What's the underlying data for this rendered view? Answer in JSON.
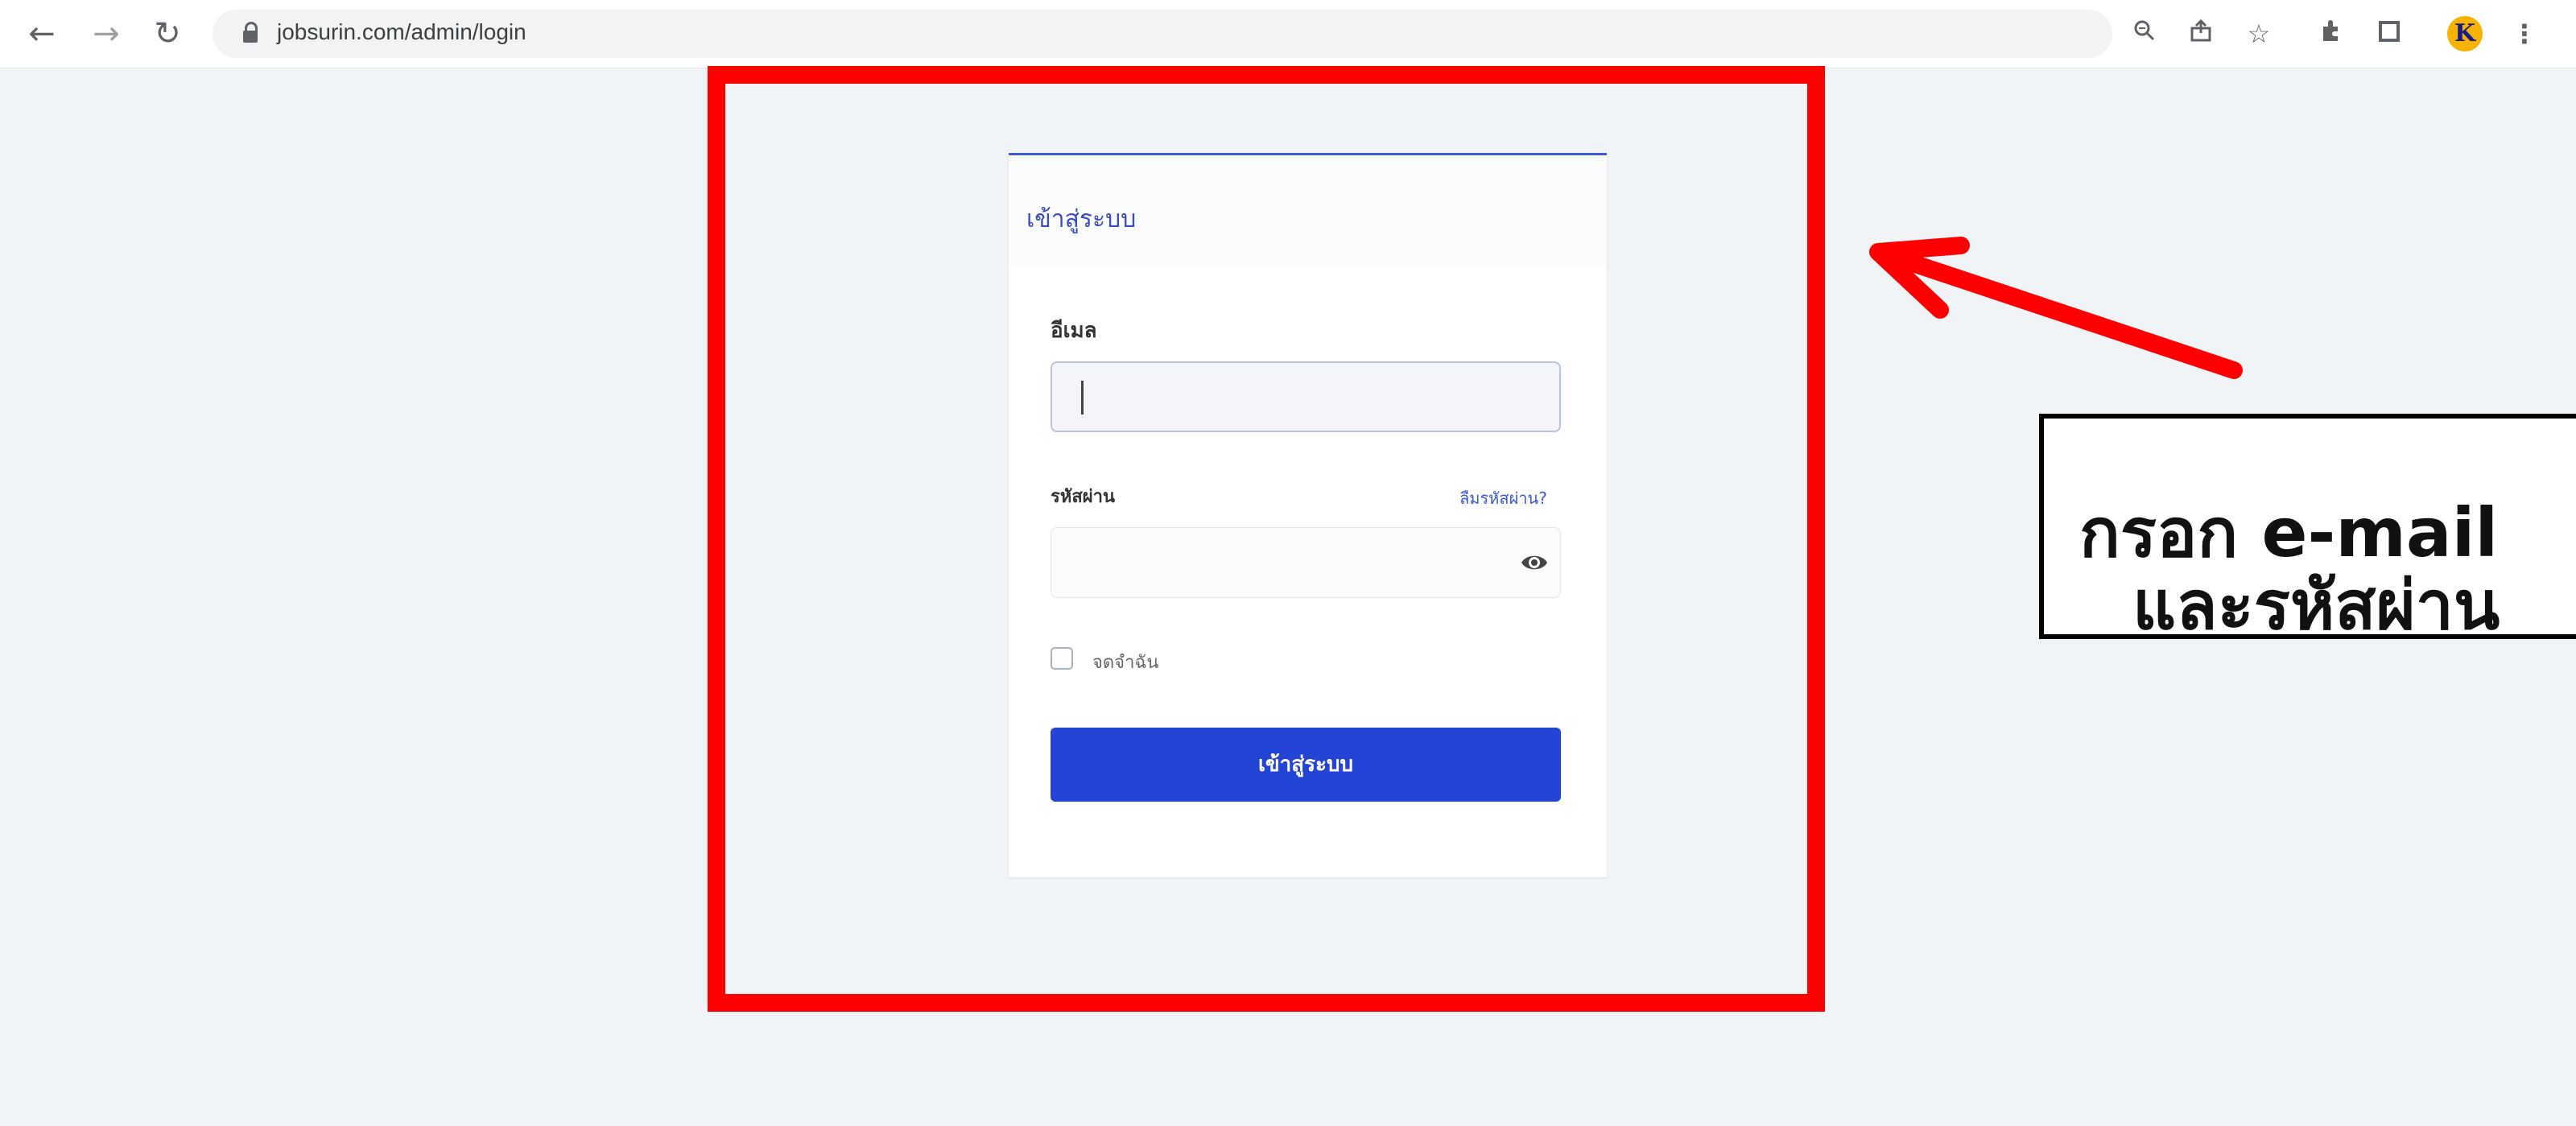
{
  "browser": {
    "url": "jobsurin.com/admin/login",
    "avatar_letter": "K",
    "icons": [
      "back-arrow-icon",
      "forward-arrow-icon",
      "reload-icon",
      "lock-icon",
      "zoom-icon",
      "share-icon",
      "star-icon",
      "extensions-icon",
      "sidebar-icon",
      "profile-avatar",
      "menu-icon"
    ]
  },
  "login": {
    "title": "เข้าสู่ระบบ",
    "email_label": "อีเมล",
    "email_value": "",
    "password_label": "รหัสผ่าน",
    "forgot_password": "ลืมรหัสผ่าน?",
    "password_value": "",
    "remember_label": "จดจำฉัน",
    "submit_label": "เข้าสู่ระบบ"
  },
  "annotation": {
    "line1": "กรอก e-mail",
    "line2": "และรหัสผ่าน",
    "highlight_color": "#ff0000"
  },
  "colors": {
    "primary": "#2344d4",
    "page_bg": "#f1f4f7"
  }
}
